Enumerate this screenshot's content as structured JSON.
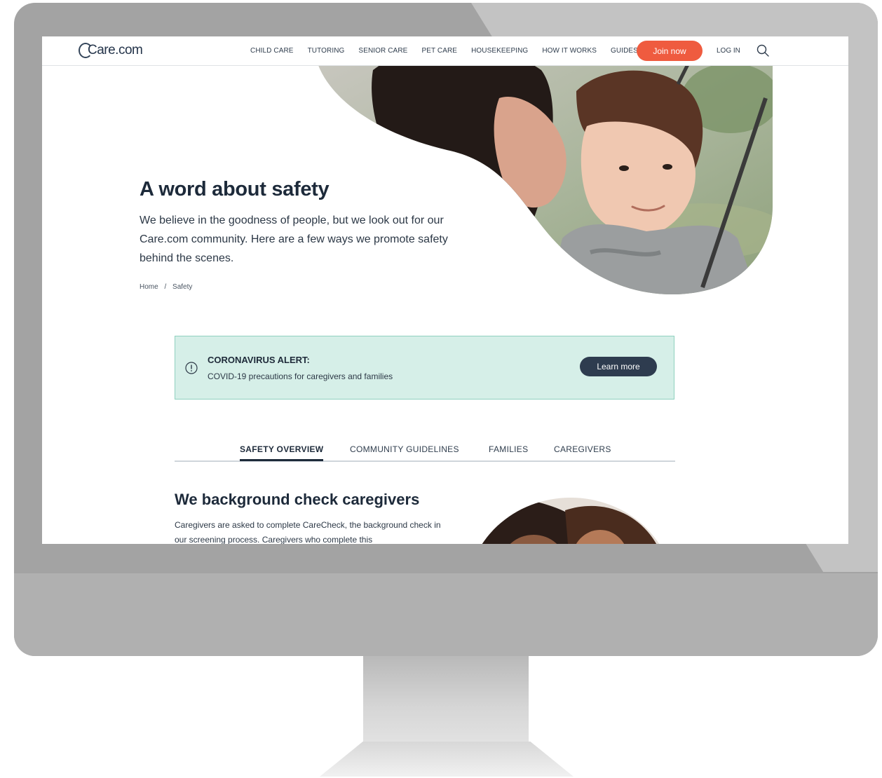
{
  "brand": {
    "logo_text": "Care.com",
    "accent": "#ef5b3f",
    "navy": "#2e3c4f",
    "alert_bg": "#d6efe8"
  },
  "nav": {
    "links": [
      "CHILD CARE",
      "TUTORING",
      "SENIOR CARE",
      "PET CARE",
      "HOUSEKEEPING",
      "HOW IT WORKS",
      "GUIDES"
    ],
    "join_label": "Join now",
    "login_label": "LOG IN",
    "search_icon": "search-icon"
  },
  "hero": {
    "title": "A word about safety",
    "body": "We believe in the goodness of people, but we look out for our Care.com community. Here are a few ways we promote safety behind the scenes."
  },
  "breadcrumb": {
    "home": "Home",
    "separator": "/",
    "current": "Safety"
  },
  "alert": {
    "icon": "info-icon",
    "title": "CORONAVIRUS ALERT:",
    "text": "COVID-19 precautions for caregivers and families",
    "button_label": "Learn more"
  },
  "tabs": [
    "SAFETY OVERVIEW",
    "COMMUNITY GUIDELINES",
    "FAMILIES",
    "CAREGIVERS"
  ],
  "active_tab": "SAFETY OVERVIEW",
  "section": {
    "title": "We background check caregivers",
    "body": "Caregivers are asked to complete CareCheck, the background check in our screening process. Caregivers who complete this"
  }
}
